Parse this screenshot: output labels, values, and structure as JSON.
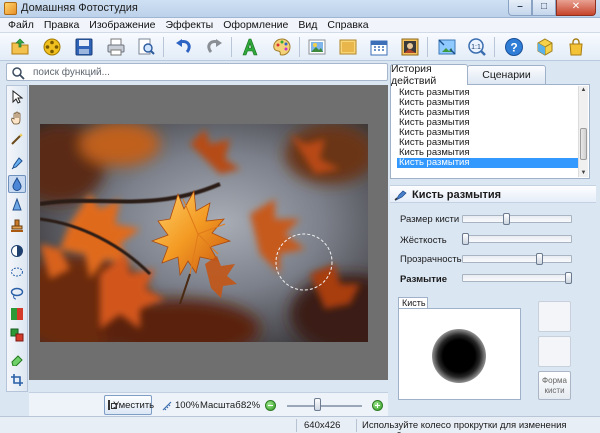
{
  "window": {
    "title": "Домашняя Фотостудия",
    "controls": {
      "minimize": "–",
      "maximize": "□",
      "close": "✕"
    }
  },
  "menu": {
    "items": [
      "Файл",
      "Правка",
      "Изображение",
      "Эффекты",
      "Оформление",
      "Вид",
      "Справка"
    ]
  },
  "toolbar": {
    "buttons": [
      "open-folder-icon",
      "film-reel-icon",
      "save-disk-icon",
      "print-icon",
      "print-preview-icon",
      "undo-icon",
      "redo-icon",
      "text-tool-icon",
      "palette-icon",
      "photo-frame-icon",
      "picture-icon",
      "calendar-icon",
      "photo-collage-icon",
      "resize-icon",
      "actual-size-icon",
      "help-icon",
      "3d-box-icon",
      "shopping-bag-icon"
    ]
  },
  "search": {
    "placeholder": "поиск функций..."
  },
  "tools": [
    "pointer-tool",
    "hand-tool",
    "magic-wand-tool",
    "eyedropper-tool",
    "blur-drop-tool",
    "sharpen-tool",
    "stamp-tool",
    "contrast-tool",
    "ellipse-select-tool",
    "lasso-tool",
    "color-balance-tool",
    "color-swap-tool",
    "eraser-tool",
    "crop-tool"
  ],
  "active_tool": "blur-drop-tool",
  "canvas": {
    "image_size": "640x426"
  },
  "bottom": {
    "fit_label": "Уместить",
    "actual_label": "100%",
    "scale_label": "Масштаб:",
    "scale_value": "82%",
    "zoom_slider_position": 0.4
  },
  "status": {
    "dimensions": "640x426",
    "hint": "Используйте колесо прокрутки для изменения масштаба"
  },
  "panel": {
    "tabs": [
      "История действий",
      "Сценарии"
    ],
    "active_tab": "История действий",
    "history": [
      "Кисть размытия",
      "Кисть размытия",
      "Кисть размытия",
      "Кисть размытия",
      "Кисть размытия",
      "Кисть размытия",
      "Кисть размытия",
      "Кисть размытия"
    ],
    "history_selected_index": 7,
    "tool_title": "Кисть размытия",
    "params": [
      {
        "label": "Размер кисти",
        "bold": false,
        "value": 0.4
      },
      {
        "label": "Жёсткость",
        "bold": false,
        "value": 0.0
      },
      {
        "label": "Прозрачность",
        "bold": false,
        "value": 0.72
      },
      {
        "label": "Размытие",
        "bold": true,
        "value": 1.0
      }
    ],
    "brush_tab": "Кисть",
    "shape_button": "Форма кисти"
  },
  "colors": {
    "accent": "#3399ff",
    "selection_blue": "#3399ff",
    "zoom_green": "#2e9b22"
  }
}
